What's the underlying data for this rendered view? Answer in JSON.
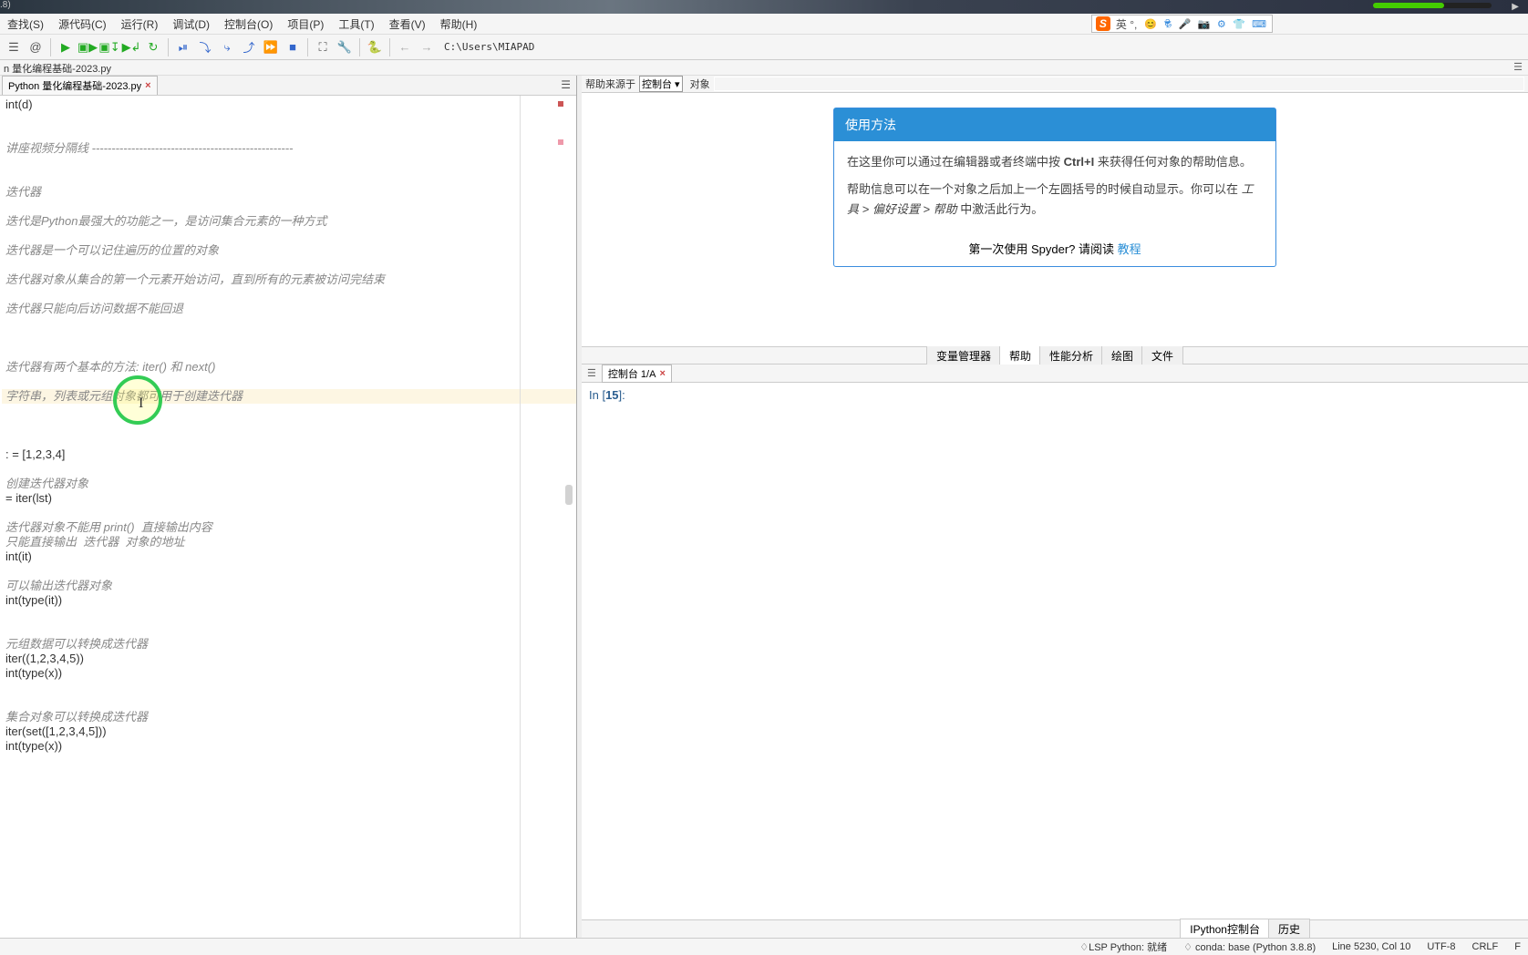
{
  "top": {
    "ver": ".8)",
    "arrow": "▶"
  },
  "ime": {
    "s": "S",
    "text": "英 °,",
    "icons": [
      "😊",
      "🕏",
      "🎤",
      "📷",
      "⚙",
      "👕",
      "⌨"
    ]
  },
  "menu": [
    "查找(S)",
    "源代码(C)",
    "运行(R)",
    "调试(D)",
    "控制台(O)",
    "项目(P)",
    "工具(T)",
    "查看(V)",
    "帮助(H)"
  ],
  "path": "C:\\Users\\MIAPAD",
  "breadcrumb": "n 量化编程基础-2023.py",
  "tab": {
    "label": "Python 量化编程基础-2023.py",
    "close": "×"
  },
  "code": [
    {
      "t": "int(d)",
      "cls": ""
    },
    {
      "t": "",
      "cls": ""
    },
    {
      "t": "",
      "cls": ""
    },
    {
      "t": "讲座视频分隔线 ---------------------------------------------------",
      "cls": "comment"
    },
    {
      "t": "",
      "cls": ""
    },
    {
      "t": "",
      "cls": ""
    },
    {
      "t": "迭代器",
      "cls": "comment"
    },
    {
      "t": "",
      "cls": ""
    },
    {
      "t": "迭代是Python最强大的功能之一，是访问集合元素的一种方式",
      "cls": "comment"
    },
    {
      "t": "",
      "cls": ""
    },
    {
      "t": "迭代器是一个可以记住遍历的位置的对象",
      "cls": "comment"
    },
    {
      "t": "",
      "cls": ""
    },
    {
      "t": "迭代器对象从集合的第一个元素开始访问，直到所有的元素被访问完结束",
      "cls": "comment"
    },
    {
      "t": "",
      "cls": ""
    },
    {
      "t": "迭代器只能向后访问数据不能回退",
      "cls": "comment"
    },
    {
      "t": "",
      "cls": ""
    },
    {
      "t": "",
      "cls": ""
    },
    {
      "t": "",
      "cls": ""
    },
    {
      "t": "迭代器有两个基本的方法: iter() 和 next()",
      "cls": "comment"
    },
    {
      "t": "",
      "cls": ""
    },
    {
      "t": "字符串，列表或元组对象都可用于创建迭代器",
      "cls": "comment hl"
    },
    {
      "t": "",
      "cls": ""
    },
    {
      "t": "",
      "cls": ""
    },
    {
      "t": "",
      "cls": ""
    },
    {
      "t": ": = [1,2,3,4]",
      "cls": ""
    },
    {
      "t": "",
      "cls": ""
    },
    {
      "t": "创建迭代器对象",
      "cls": "comment"
    },
    {
      "t": "= iter(lst)",
      "cls": ""
    },
    {
      "t": "",
      "cls": ""
    },
    {
      "t": "迭代器对象不能用 print()  直接输出内容",
      "cls": "comment"
    },
    {
      "t": "只能直接输出  迭代器  对象的地址",
      "cls": "comment"
    },
    {
      "t": "int(it)",
      "cls": ""
    },
    {
      "t": "",
      "cls": ""
    },
    {
      "t": "可以输出迭代器对象",
      "cls": "comment"
    },
    {
      "t": "int(type(it))",
      "cls": ""
    },
    {
      "t": "",
      "cls": ""
    },
    {
      "t": "",
      "cls": ""
    },
    {
      "t": "元组数据可以转换成迭代器",
      "cls": "comment"
    },
    {
      "t": "iter((1,2,3,4,5))",
      "cls": ""
    },
    {
      "t": "int(type(x))",
      "cls": ""
    },
    {
      "t": "",
      "cls": ""
    },
    {
      "t": "",
      "cls": ""
    },
    {
      "t": "集合对象可以转换成迭代器",
      "cls": "comment"
    },
    {
      "t": "iter(set([1,2,3,4,5]))",
      "cls": ""
    },
    {
      "t": "int(type(x))",
      "cls": ""
    }
  ],
  "help_top": {
    "src_label": "帮助来源于",
    "combo": "控制台",
    "obj_label": "对象"
  },
  "help_card": {
    "title": "使用方法",
    "p1a": "在这里你可以通过在编辑器或者终端中按 ",
    "p1b": "Ctrl+I",
    "p1c": " 来获得任何对象的帮助信息。",
    "p2a": "帮助信息可以在一个对象之后加上一个左圆括号的时候自动显示。你可以在 ",
    "p2b": "工具 > 偏好设置 > 帮助",
    "p2c": " 中激活此行为。",
    "fa": "第一次使用 Spyder? 请阅读 ",
    "fb": "教程"
  },
  "rtabs": [
    "变量管理器",
    "帮助",
    "性能分析",
    "绘图",
    "文件"
  ],
  "console_tab": {
    "label": "控制台 1/A",
    "close": "×"
  },
  "console": {
    "prompt": "In [",
    "n": "15",
    "suffix": "]:"
  },
  "brtabs": [
    "IPython控制台",
    "历史"
  ],
  "status": {
    "lsp": "♢LSP Python: 就绪",
    "conda": "♢ conda: base (Python 3.8.8)",
    "pos": "Line 5230, Col 10",
    "enc": "UTF-8",
    "eol": "CRLF",
    "last": "F"
  }
}
